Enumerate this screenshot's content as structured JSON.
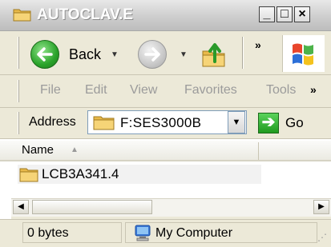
{
  "window": {
    "title": "AUTOCLAV.E"
  },
  "toolbar": {
    "back_label": "Back",
    "overflow": "»"
  },
  "menu": {
    "items": [
      "File",
      "Edit",
      "View",
      "Favorites",
      "Tools"
    ],
    "overflow": "»"
  },
  "address": {
    "label": "Address",
    "value": "F:SES3000B",
    "go_label": "Go"
  },
  "list": {
    "column_name": "Name",
    "items": [
      {
        "name": "LCB3A341.4"
      }
    ]
  },
  "status": {
    "size_text": "0 bytes",
    "zone": "My Computer"
  }
}
